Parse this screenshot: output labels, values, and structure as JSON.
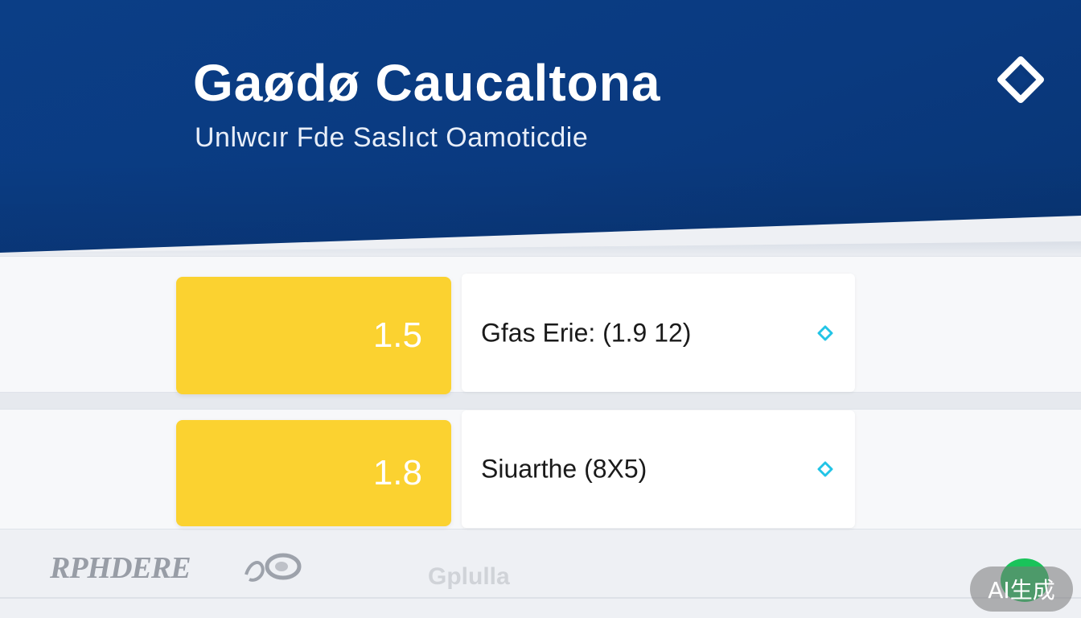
{
  "header": {
    "title": "Gaødø Caucaltona",
    "subtitle": "Unlwcır Fde Saslıct Oamoticdie",
    "corner_icon": "diamond-chevron-icon"
  },
  "rows": [
    {
      "value": "1.5",
      "label": "Gfas Erie: (1.9 12)",
      "chevron_icon": "chevron-right-icon"
    },
    {
      "value": "1.8",
      "label": "Siuarthe (8X5)",
      "chevron_icon": "chevron-right-icon"
    }
  ],
  "footer": {
    "brand_left": "RPHDERE",
    "brand_center": "Gplulla",
    "ai_badge": "AI生成"
  },
  "colors": {
    "header_bg": "#0a3a80",
    "tile_yellow": "#fbd230",
    "chevron_cyan": "#22c4e6",
    "ai_green": "#19c35a"
  }
}
